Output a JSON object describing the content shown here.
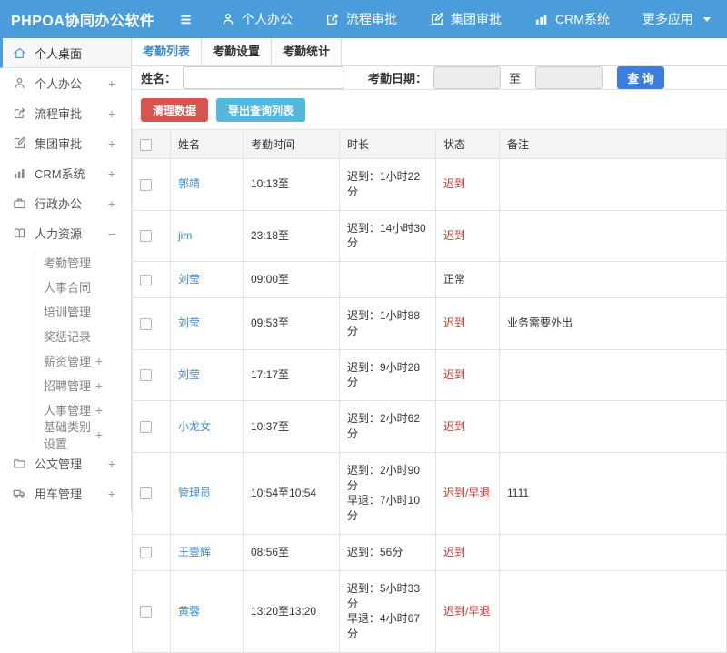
{
  "topbar": {
    "logo": "PHPOA协同办公软件",
    "nav": [
      {
        "label": "个人办公"
      },
      {
        "label": "流程审批"
      },
      {
        "label": "集团审批"
      },
      {
        "label": "CRM系统"
      }
    ],
    "more_label": "更多应用"
  },
  "sidebar": {
    "items": [
      {
        "label": "个人桌面",
        "expand": ""
      },
      {
        "label": "个人办公",
        "expand": "+"
      },
      {
        "label": "流程审批",
        "expand": "+"
      },
      {
        "label": "集团审批",
        "expand": "+"
      },
      {
        "label": "CRM系统",
        "expand": "+"
      },
      {
        "label": "行政办公",
        "expand": "+"
      },
      {
        "label": "人力资源",
        "expand": "−"
      },
      {
        "label": "公文管理",
        "expand": "+"
      },
      {
        "label": "用车管理",
        "expand": "+"
      }
    ],
    "hr_children": [
      {
        "label": "考勤管理",
        "expand": ""
      },
      {
        "label": "人事合同",
        "expand": ""
      },
      {
        "label": "培训管理",
        "expand": ""
      },
      {
        "label": "奖惩记录",
        "expand": ""
      },
      {
        "label": "薪资管理",
        "expand": "+"
      },
      {
        "label": "招聘管理",
        "expand": "+"
      },
      {
        "label": "人事管理",
        "expand": "+"
      },
      {
        "label": "基础类别设置",
        "expand": "+"
      }
    ]
  },
  "tabs": [
    {
      "label": "考勤列表",
      "active": true
    },
    {
      "label": "考勤设置",
      "active": false
    },
    {
      "label": "考勤统计",
      "active": false
    }
  ],
  "search": {
    "name_label": "姓名：",
    "name_value": "",
    "date_label": "考勤日期：",
    "date_from_value": "",
    "to_label": "至",
    "date_to_value": "",
    "submit_label": "查 询"
  },
  "actions": {
    "clean_label": "清理数据",
    "export_label": "导出查询列表"
  },
  "table": {
    "headers": [
      "姓名",
      "考勤时间",
      "时长",
      "状态",
      "备注"
    ],
    "rows": [
      {
        "name": "郭靖",
        "time": "10:13至",
        "duration1": "迟到：1小时22分",
        "duration2": "",
        "status": "迟到",
        "remark": ""
      },
      {
        "name": "jim",
        "time": "23:18至",
        "duration1": "迟到：14小时30分",
        "duration2": "",
        "status": "迟到",
        "remark": ""
      },
      {
        "name": "刘莹",
        "time": "09:00至",
        "duration1": "",
        "duration2": "",
        "status": "正常",
        "remark": ""
      },
      {
        "name": "刘莹",
        "time": "09:53至",
        "duration1": "迟到：1小时88分",
        "duration2": "",
        "status": "迟到",
        "remark": "业务需要外出"
      },
      {
        "name": "刘莹",
        "time": "17:17至",
        "duration1": "迟到：9小时28分",
        "duration2": "",
        "status": "迟到",
        "remark": ""
      },
      {
        "name": "小龙女",
        "time": "10:37至",
        "duration1": "迟到：2小时62分",
        "duration2": "",
        "status": "迟到",
        "remark": ""
      },
      {
        "name": "管理员",
        "time": "10:54至10:54",
        "duration1": "迟到：2小时90分",
        "duration2": "早退：7小时10分",
        "status": "迟到/早退",
        "remark": "1111"
      },
      {
        "name": "王壹辉",
        "time": "08:56至",
        "duration1": "迟到：56分",
        "duration2": "",
        "status": "迟到",
        "remark": ""
      },
      {
        "name": "黄蓉",
        "time": "13:20至13:20",
        "duration1": "迟到：5小时33分",
        "duration2": "早退：4小时67分",
        "status": "迟到/早退",
        "remark": ""
      }
    ]
  },
  "colors": {
    "topbar_blue": "#4a9cdb",
    "active_tab_blue": "#428bca",
    "link_blue": "#428bca",
    "status_red": "#cb3b32",
    "search_button_blue": "#3c7edd",
    "clean_button_red": "#d9534f",
    "export_button_blue": "#54b8dd"
  }
}
